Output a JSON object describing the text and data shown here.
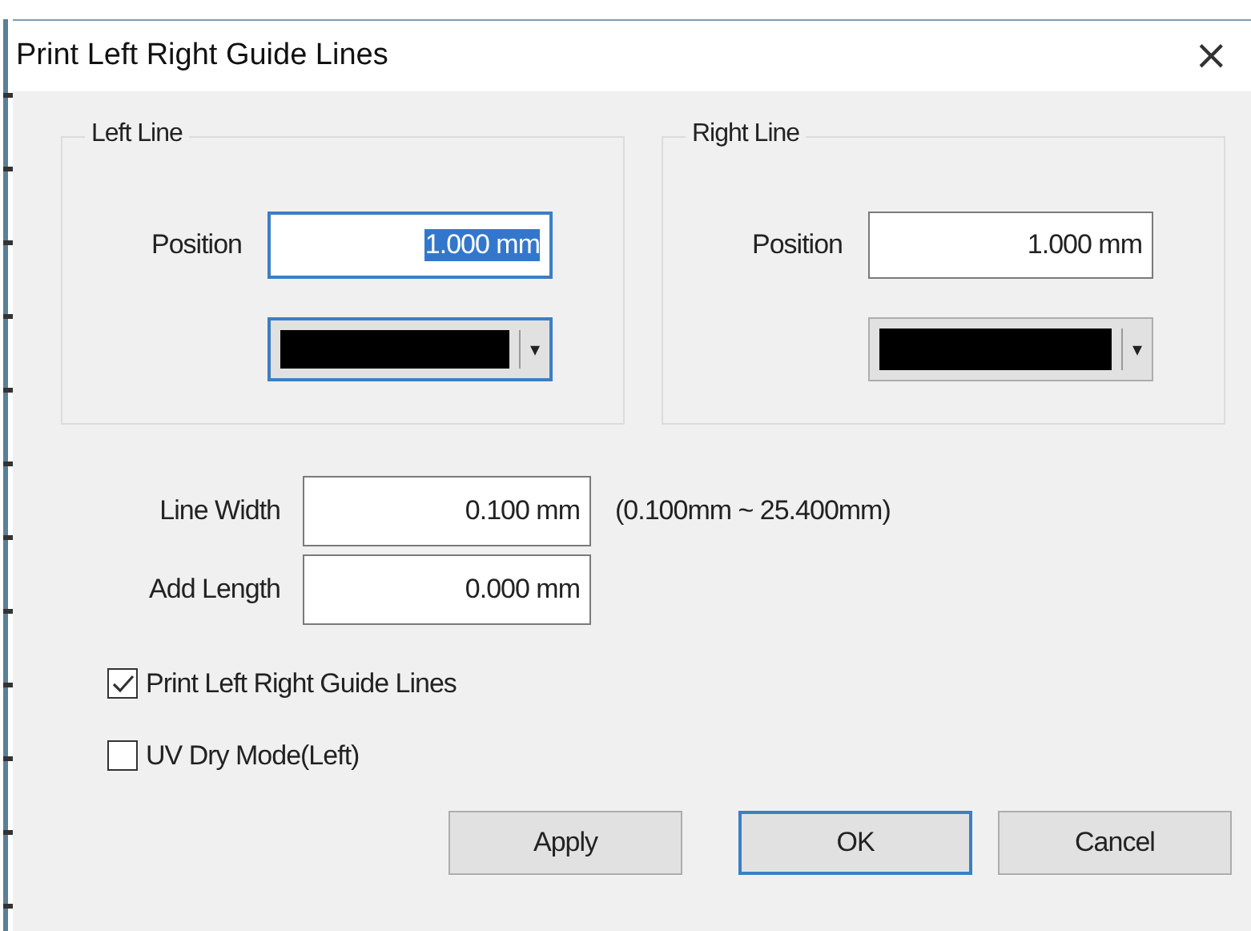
{
  "window": {
    "title": "Print Left Right Guide Lines",
    "close": "×"
  },
  "groups": [
    {
      "title": "Left Line",
      "position": {
        "label": "Position",
        "value": "1.000 mm",
        "text_selected": true
      },
      "color_dropdown": {
        "color": "#000000",
        "highlighted": true,
        "arrow": "▾"
      }
    },
    {
      "title": "Right Line",
      "position": {
        "label": "Position",
        "value": "1.000 mm",
        "text_selected": false
      },
      "color_dropdown": {
        "color": "#000000",
        "highlighted": false,
        "arrow": "▾"
      }
    }
  ],
  "fields": [
    {
      "label": "Line Width",
      "value": "0.100 mm",
      "hint": "(0.100mm ~ 25.400mm)"
    },
    {
      "label": "Add Length",
      "value": "0.000 mm"
    }
  ],
  "checkboxes": [
    {
      "label": "Print Left Right Guide Lines",
      "checked": true
    },
    {
      "label": "UV Dry Mode(Left)",
      "checked": false
    }
  ],
  "buttons": [
    {
      "label": "Apply",
      "default": false
    },
    {
      "label": "OK",
      "default": true
    },
    {
      "label": "Cancel",
      "default": false
    }
  ]
}
